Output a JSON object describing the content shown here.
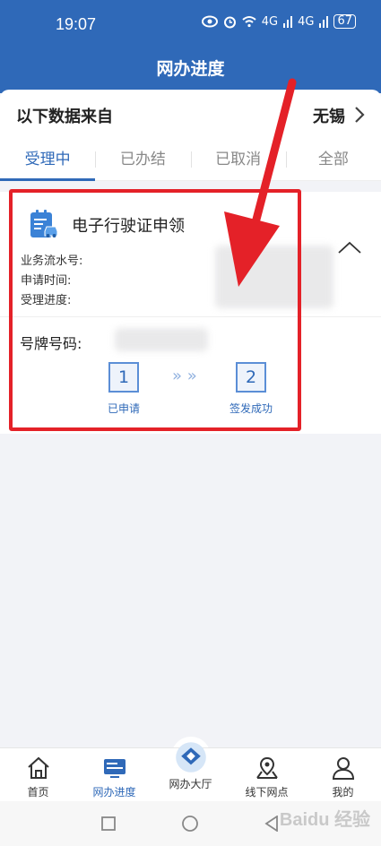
{
  "status_bar": {
    "time": "19:07",
    "network_1": "4G",
    "network_2": "4G",
    "battery": "67"
  },
  "header": {
    "title": "网办进度"
  },
  "region": {
    "label": "以下数据来自",
    "value": "无锡"
  },
  "tabs": [
    {
      "label": "受理中",
      "active": true
    },
    {
      "label": "已办结",
      "active": false
    },
    {
      "label": "已取消",
      "active": false
    },
    {
      "label": "全部",
      "active": false
    }
  ],
  "card": {
    "title": "电子行驶证申领",
    "fields": {
      "serial_label": "业务流水号:",
      "time_label": "申请时间:",
      "progress_label": "受理进度:"
    },
    "plate_label": "号牌号码:",
    "steps": [
      {
        "number": "1",
        "label": "已申请"
      },
      {
        "number": "2",
        "label": "签发成功"
      }
    ],
    "step_arrow": "» »"
  },
  "bottom_nav": [
    {
      "label": "首页",
      "icon": "home-icon",
      "active": false
    },
    {
      "label": "网办进度",
      "icon": "monitor-icon",
      "active": true
    },
    {
      "label": "网办大厅",
      "icon": "hall-icon",
      "active": false
    },
    {
      "label": "线下网点",
      "icon": "map-pin-icon",
      "active": false
    },
    {
      "label": "我的",
      "icon": "user-icon",
      "active": false
    }
  ],
  "watermark": "Baidu 经验",
  "colors": {
    "primary": "#2f69b8",
    "annotation_red": "#e42128"
  }
}
